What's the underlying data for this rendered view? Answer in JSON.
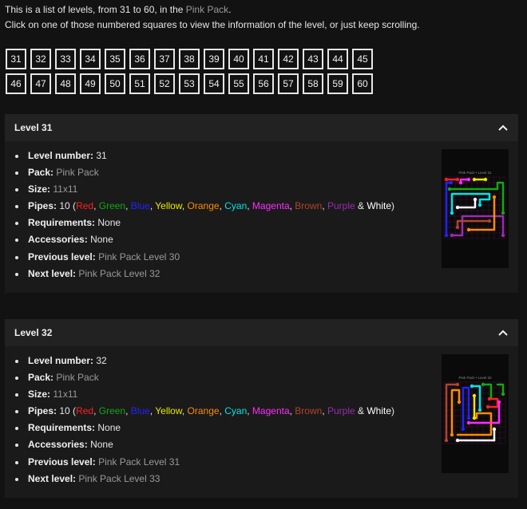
{
  "intro": {
    "line1_prefix": "This is a list of levels, from 31 to 60, in the ",
    "line1_link": "Pink Pack",
    "line1_suffix": ".",
    "line2": "Click on one of those numbered squares to view the information of the level, or just keep scrolling."
  },
  "level_numbers": {
    "row1": [
      "31",
      "32",
      "33",
      "34",
      "35",
      "36",
      "37",
      "38",
      "39",
      "40",
      "41",
      "42",
      "43",
      "44",
      "45"
    ],
    "row2": [
      "46",
      "47",
      "48",
      "49",
      "50",
      "51",
      "52",
      "53",
      "54",
      "55",
      "56",
      "57",
      "58",
      "59",
      "60"
    ]
  },
  "labels": {
    "level_number": "Level number:",
    "pack": "Pack:",
    "size": "Size:",
    "pipes": "Pipes:",
    "requirements": "Requirements:",
    "accessories": "Accessories:",
    "previous": "Previous level:",
    "next": "Next level:"
  },
  "pipe_names": {
    "red": "Red",
    "green": "Green",
    "blue": "Blue",
    "yellow": "Yellow",
    "orange": "Orange",
    "cyan": "Cyan",
    "magenta": "Magenta",
    "brown": "Brown",
    "purple": "Purple",
    "white": "White",
    "sep": ", ",
    "and": " & "
  },
  "colors": {
    "red": "#ff2020",
    "green": "#13a813",
    "blue": "#2222ff",
    "yellow": "#eaea00",
    "orange": "#ff8c00",
    "cyan": "#00e6e6",
    "magenta": "#ff2bff",
    "brown": "#b0442c",
    "purple": "#9a2bb0",
    "white": "#ffffff"
  },
  "panels": [
    {
      "title": "Level 31",
      "level_number": "31",
      "pack": "Pink Pack",
      "size": "11x11",
      "pipes_count": "10",
      "requirements": "None",
      "accessories": "None",
      "previous": "Pink Pack Level 30",
      "next": "Pink Pack Level 32",
      "thumb_caption": "Pink Pack • Level 31"
    },
    {
      "title": "Level 32",
      "level_number": "32",
      "pack": "Pink Pack",
      "size": "11x11",
      "pipes_count": "10",
      "requirements": "None",
      "accessories": "None",
      "previous": "Pink Pack Level 31",
      "next": "Pink Pack Level 33",
      "thumb_caption": "Pink Pack • Level 32"
    }
  ]
}
